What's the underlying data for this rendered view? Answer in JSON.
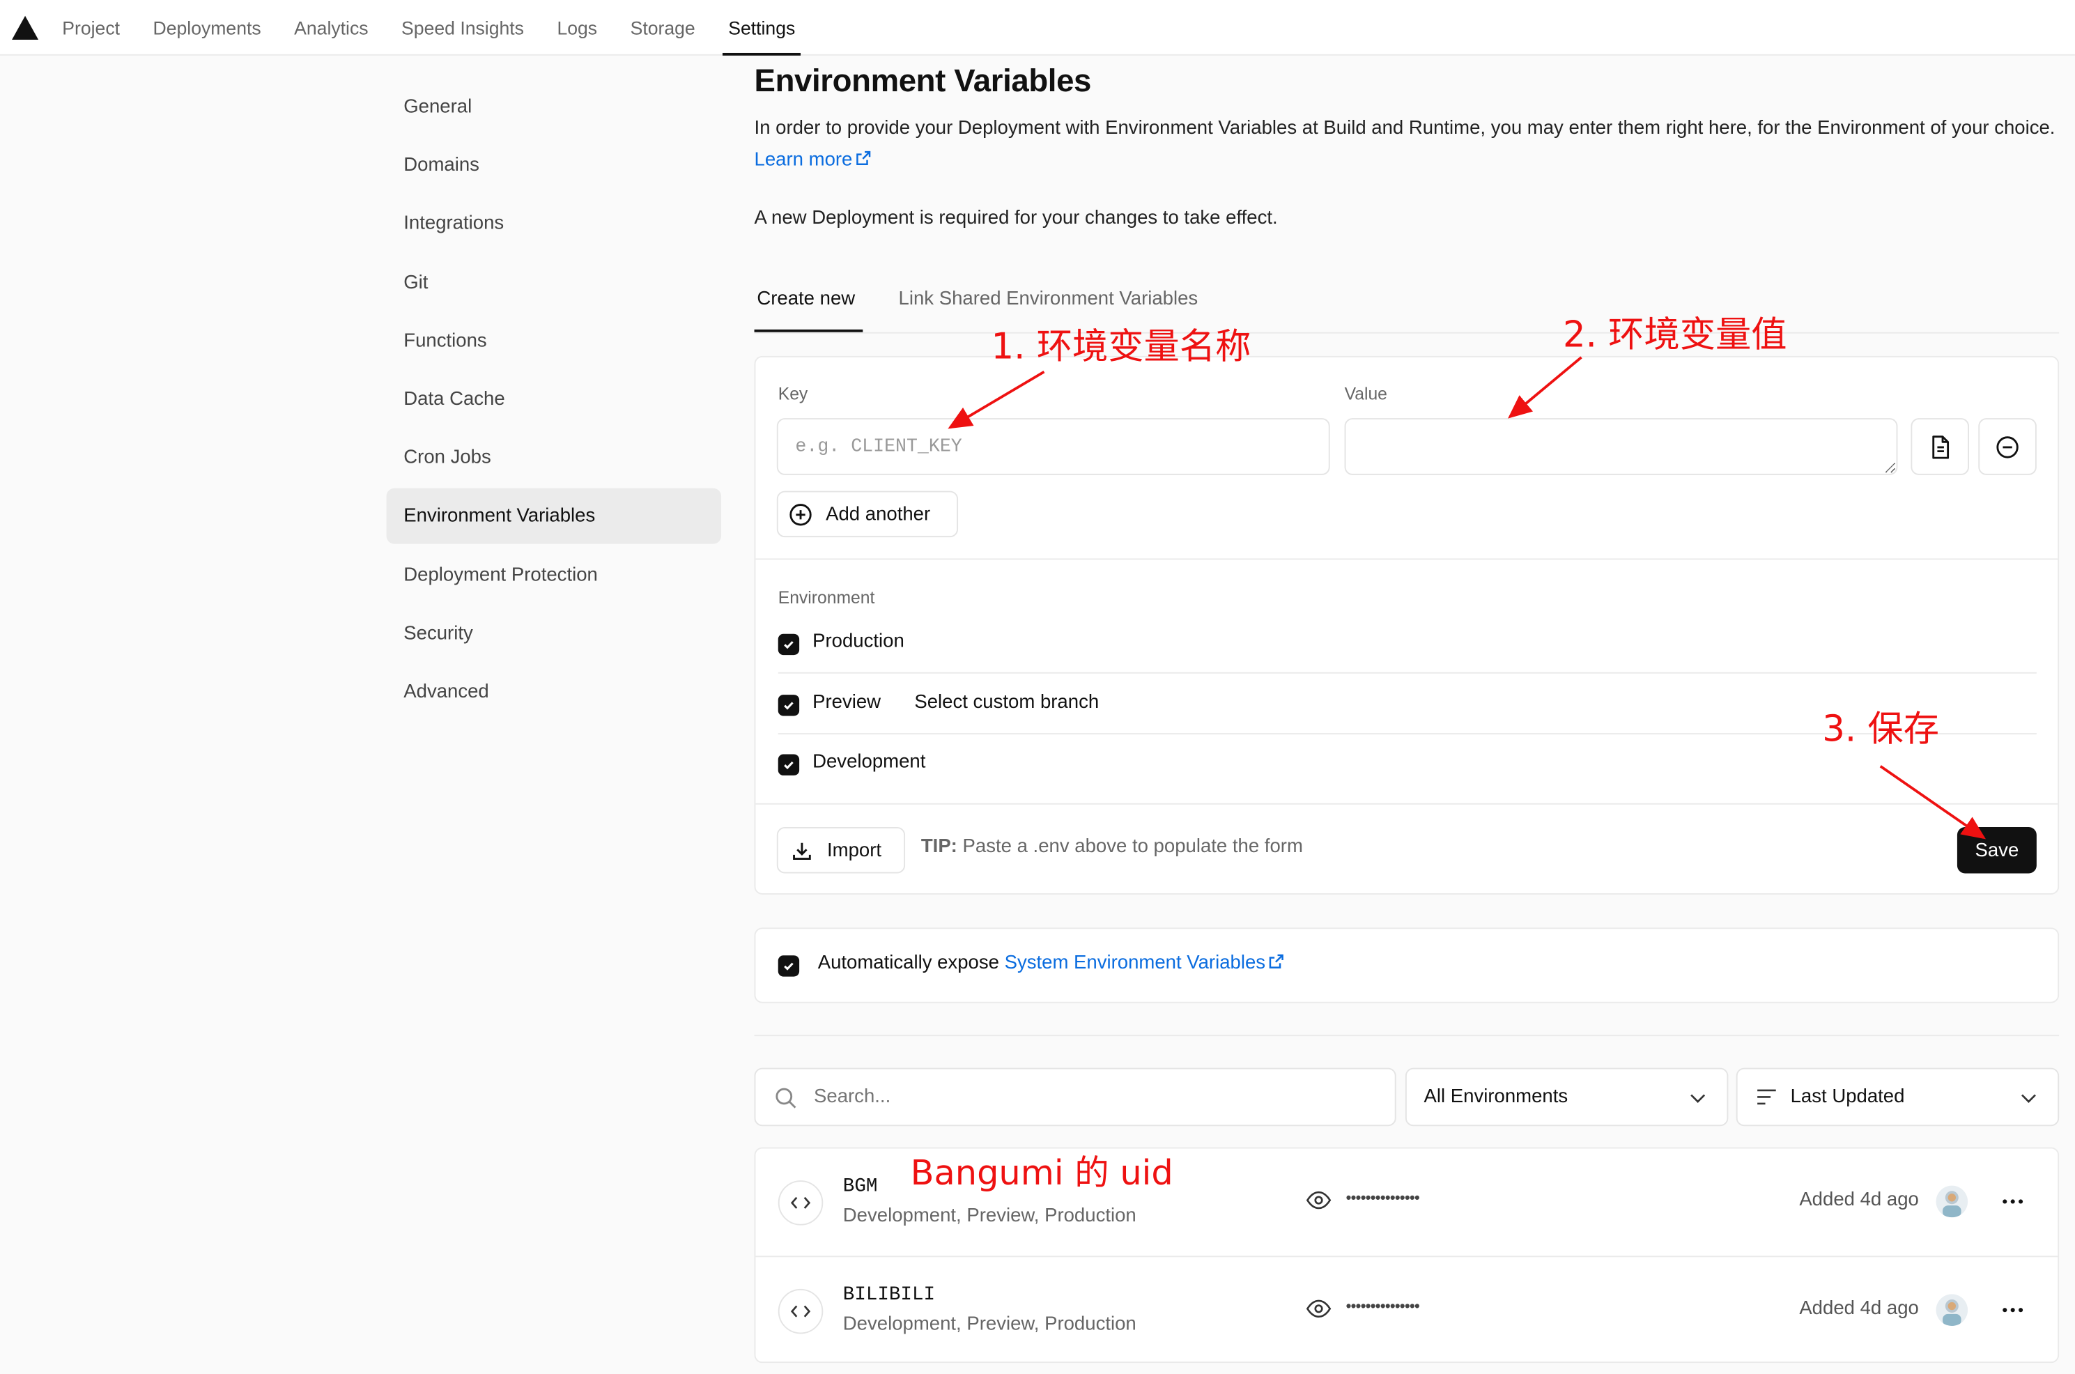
{
  "nav": {
    "items": [
      "Project",
      "Deployments",
      "Analytics",
      "Speed Insights",
      "Logs",
      "Storage",
      "Settings"
    ],
    "active": "Settings"
  },
  "sidebar": {
    "items": [
      "General",
      "Domains",
      "Integrations",
      "Git",
      "Functions",
      "Data Cache",
      "Cron Jobs",
      "Environment Variables",
      "Deployment Protection",
      "Security",
      "Advanced"
    ],
    "active": "Environment Variables"
  },
  "page": {
    "title": "Environment Variables",
    "description": "In order to provide your Deployment with Environment Variables at Build and Runtime, you may enter them right here, for the Environment of your choice.",
    "learn_more": "Learn more",
    "note": "A new Deployment is required for your changes to take effect."
  },
  "tabs": {
    "create_new": "Create new",
    "link_shared": "Link Shared Environment Variables"
  },
  "form": {
    "key_label": "Key",
    "key_placeholder": "e.g. CLIENT_KEY",
    "key_value": "",
    "value_label": "Value",
    "value_value": "",
    "add_another": "Add another",
    "environment_label": "Environment",
    "environments": [
      {
        "label": "Production",
        "checked": true
      },
      {
        "label": "Preview",
        "checked": true
      },
      {
        "label": "Development",
        "checked": true
      }
    ],
    "select_custom_branch": "Select custom branch",
    "import_label": "Import",
    "tip_bold": "TIP:",
    "tip_text": "Paste a .env above to populate the form",
    "save_label": "Save"
  },
  "expose": {
    "text": "Automatically expose",
    "link": "System Environment Variables",
    "checked": true
  },
  "filters": {
    "search_placeholder": "Search...",
    "environment_select": "All Environments",
    "sort_select": "Last Updated"
  },
  "variables": [
    {
      "name": "BGM",
      "environments": "Development, Preview, Production",
      "masked": "•••••••••••••••",
      "added": "Added 4d ago"
    },
    {
      "name": "BILIBILI",
      "environments": "Development, Preview, Production",
      "masked": "•••••••••••••••",
      "added": "Added 4d ago"
    }
  ],
  "annotations": {
    "key_note": "1. 环境变量名称",
    "value_note": "2. 环境变量值",
    "save_note": "3. 保存",
    "bgm_note": "Bangumi 的 uid",
    "color": "#ee1111"
  },
  "colors": {
    "link": "#0a6cdf",
    "primary": "#111111",
    "background": "#fafafa"
  }
}
